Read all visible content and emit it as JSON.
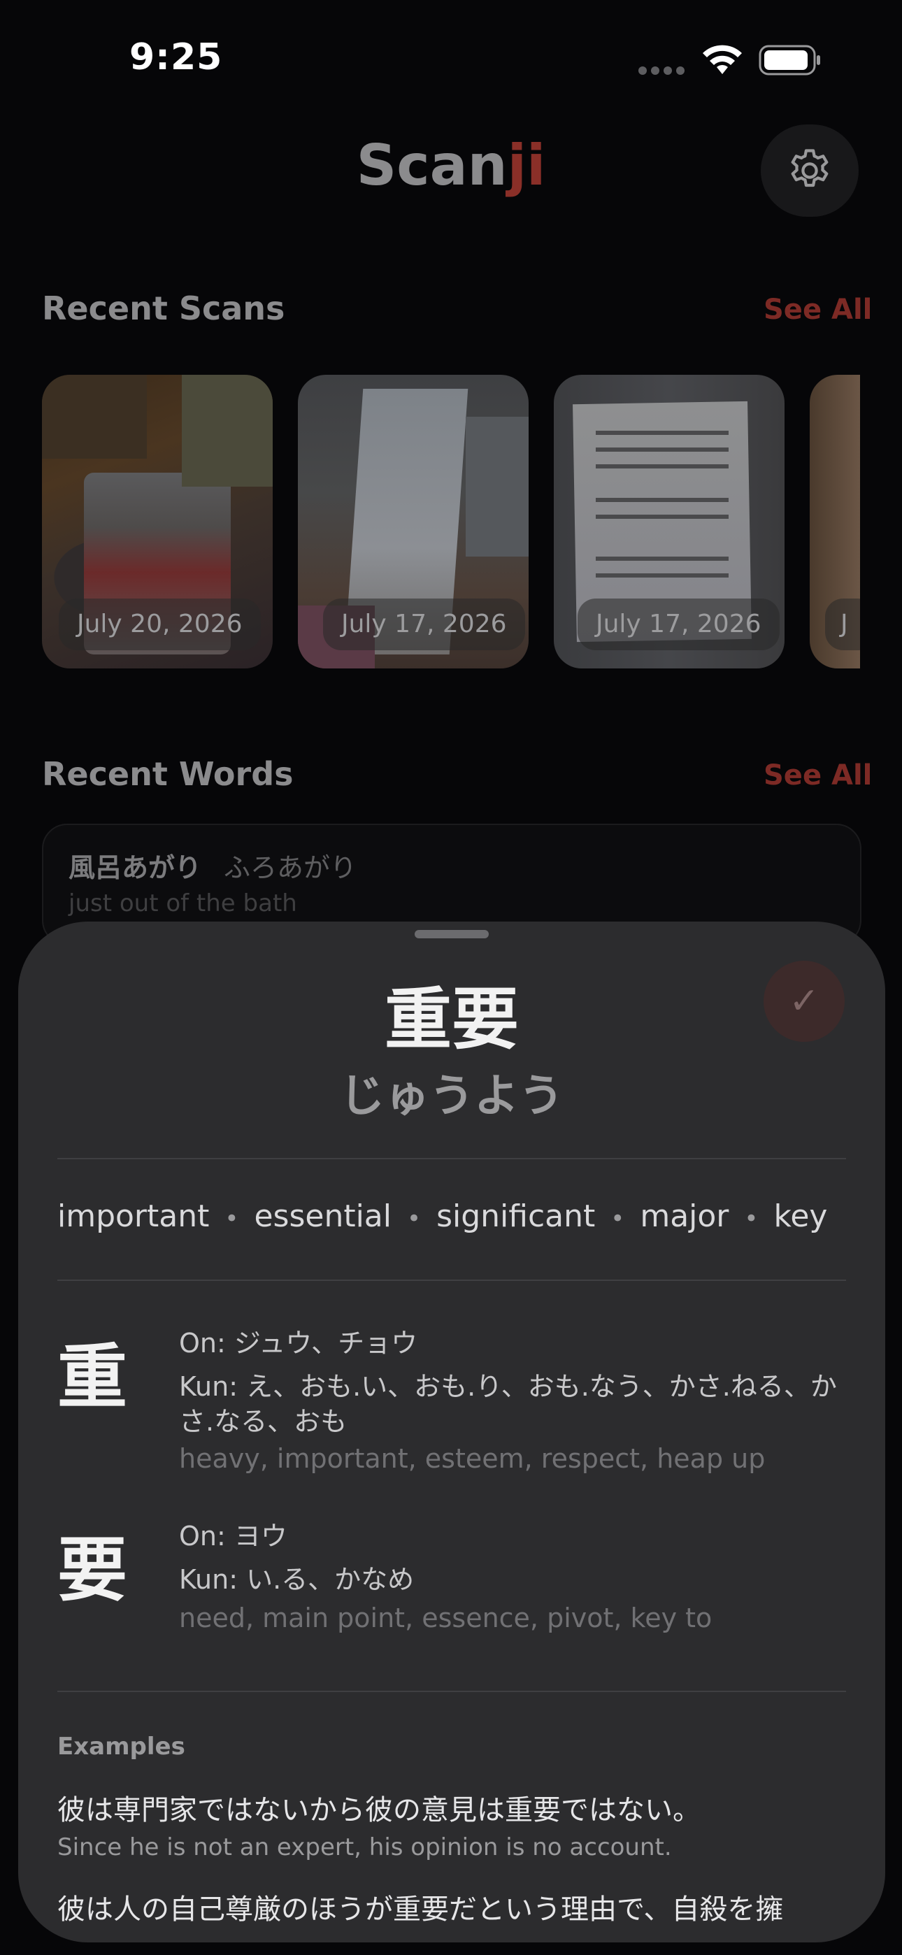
{
  "status_bar": {
    "time": "9:25"
  },
  "header": {
    "app_name_main": "Scan",
    "app_name_accent": "ji"
  },
  "recent_scans": {
    "title": "Recent Scans",
    "see_all": "See All",
    "items": [
      {
        "date": "July 20, 2026"
      },
      {
        "date": "July 17, 2026"
      },
      {
        "date": "July 17, 2026"
      },
      {
        "date": "J"
      }
    ]
  },
  "recent_words": {
    "title": "Recent Words",
    "see_all": "See All",
    "items": [
      {
        "word": "風呂あがり",
        "reading": "ふろあがり",
        "meaning": "just out of the bath"
      }
    ]
  },
  "detail": {
    "word": "重要",
    "reading": "じゅうよう",
    "check_icon": "✓",
    "meanings": [
      "important",
      "essential",
      "significant",
      "major",
      "key"
    ],
    "kanji": [
      {
        "char": "重",
        "on": "On: ジュウ、チョウ",
        "kun_line1": "Kun: え、おも.い、おも.り、おも.なう、かさ.ねる、か",
        "kun_line2": "さ.なる、おも",
        "meaning": "heavy, important, esteem, respect, heap up"
      },
      {
        "char": "要",
        "on": "On: ヨウ",
        "kun_line1": "Kun: い.る、かなめ",
        "kun_line2": "",
        "meaning": "need, main point, essence, pivot, key to"
      }
    ],
    "examples_label": "Examples",
    "examples": [
      {
        "jp": "彼は専門家ではないから彼の意見は重要ではない。",
        "en": "Since he is not an expert, his opinion is no account."
      },
      {
        "jp": "彼は人の自己尊厳のほうが重要だという理由で、自殺を擁",
        "en": ""
      }
    ]
  }
}
